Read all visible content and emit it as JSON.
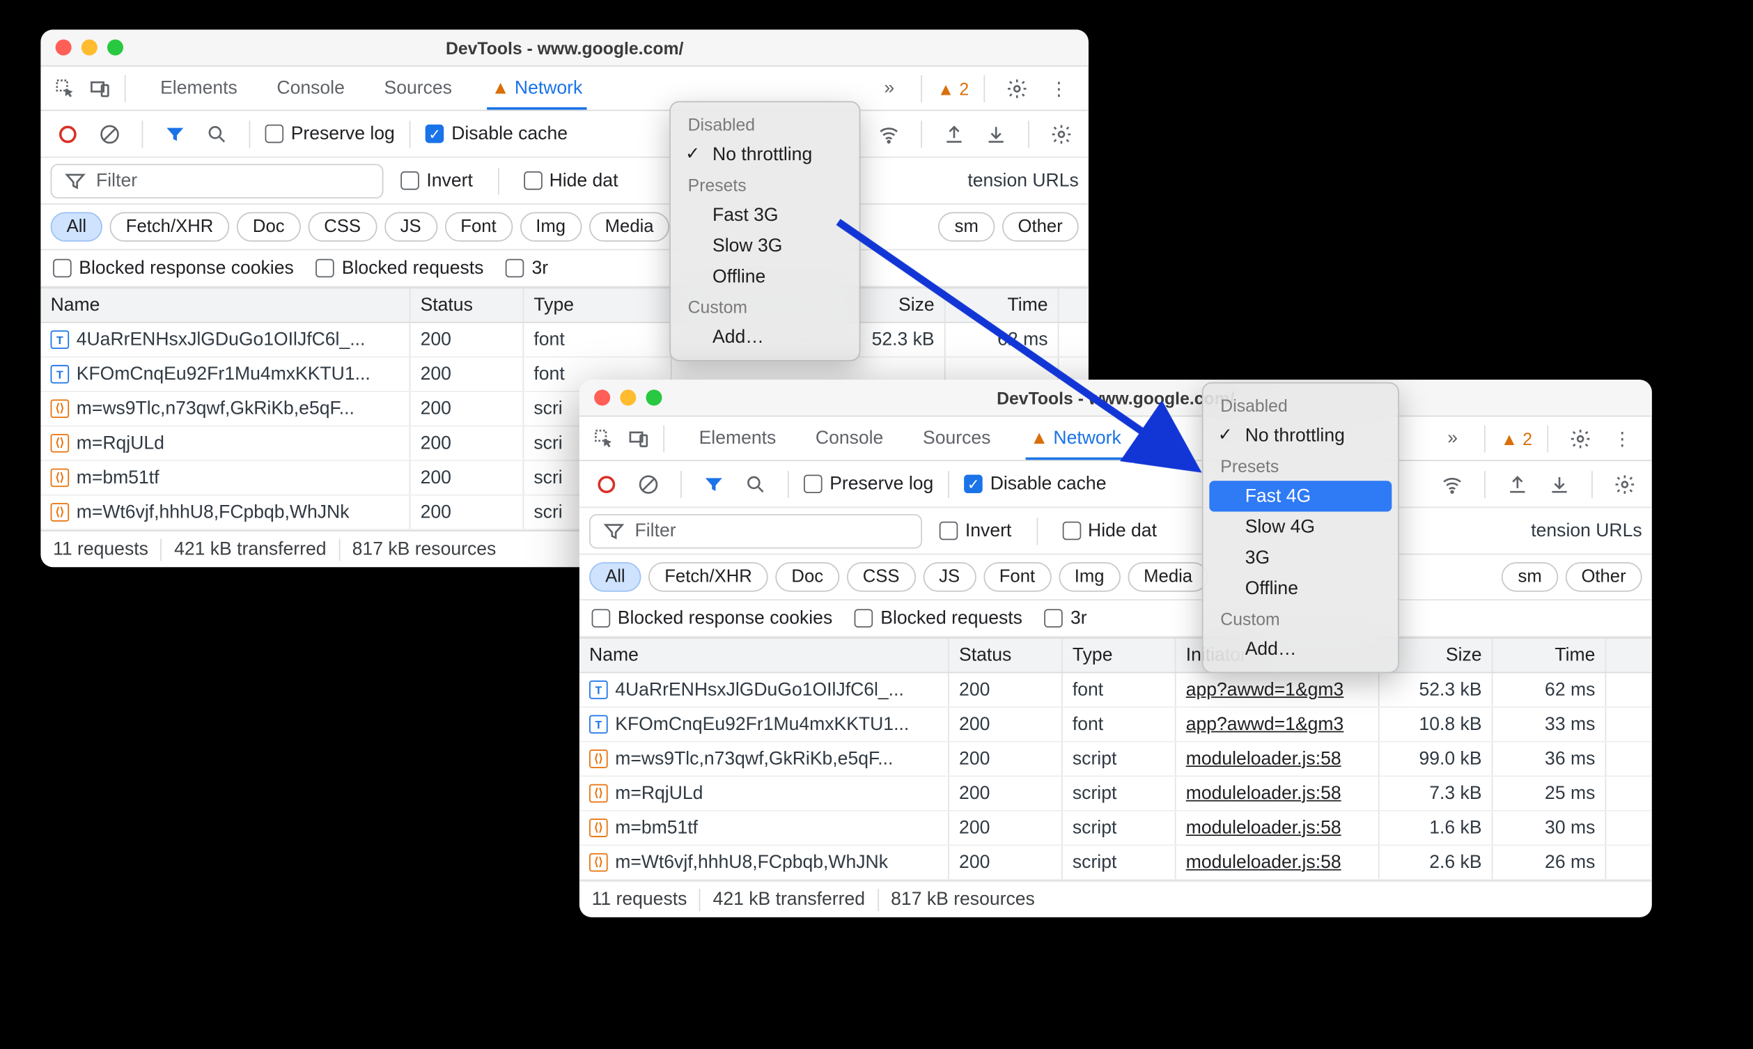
{
  "window_title": "DevTools - www.google.com/",
  "tabs": {
    "elements": "Elements",
    "console": "Console",
    "sources": "Sources",
    "network": "Network"
  },
  "warning_count": "2",
  "toolbar": {
    "preserve_log": "Preserve log",
    "disable_cache": "Disable cache"
  },
  "filter_placeholder": "Filter",
  "invert": "Invert",
  "hide_data_partial": "Hide dat",
  "extension_urls_partial": "tension URLs",
  "types": {
    "all": "All",
    "fetch": "Fetch/XHR",
    "doc": "Doc",
    "css": "CSS",
    "js": "JS",
    "font": "Font",
    "img": "Img",
    "media": "Media",
    "sm_partial": "sm",
    "other": "Other"
  },
  "checks": {
    "blocked_cookies": "Blocked response cookies",
    "blocked_requests": "Blocked requests",
    "third_partial": "3r"
  },
  "columns": {
    "name": "Name",
    "status": "Status",
    "type": "Type",
    "initiator": "Initiator",
    "size": "Size",
    "time": "Time"
  },
  "rows": [
    {
      "icon": "font",
      "name": "4UaRrENHsxJlGDuGo1OIlJfC6l_...",
      "status": "200",
      "type": "font",
      "initiator": "app?awwd=1&gm3",
      "size": "52.3 kB",
      "time": "62 ms"
    },
    {
      "icon": "font",
      "name": "KFOmCnqEu92Fr1Mu4mxKKTU1...",
      "status": "200",
      "type": "font",
      "initiator": "app?awwd=1&gm3",
      "size": "10.8 kB",
      "time": "33 ms"
    },
    {
      "icon": "script",
      "name": "m=ws9Tlc,n73qwf,GkRiKb,e5qF...",
      "status": "200",
      "type": "script",
      "initiator": "moduleloader.js:58",
      "size": "99.0 kB",
      "time": "36 ms"
    },
    {
      "icon": "script",
      "name": "m=RqjULd",
      "status": "200",
      "type": "script",
      "initiator": "moduleloader.js:58",
      "size": "7.3 kB",
      "time": "25 ms"
    },
    {
      "icon": "script",
      "name": "m=bm51tf",
      "status": "200",
      "type": "script",
      "initiator": "moduleloader.js:58",
      "size": "1.6 kB",
      "time": "30 ms"
    },
    {
      "icon": "script",
      "name": "m=Wt6vjf,hhhU8,FCpbqb,WhJNk",
      "status": "200",
      "type": "script",
      "initiator": "moduleloader.js:58",
      "size": "2.6 kB",
      "time": "26 ms"
    }
  ],
  "status": {
    "requests": "11 requests",
    "transferred": "421 kB transferred",
    "resources": "817 kB resources"
  },
  "menu_a": {
    "disabled": "Disabled",
    "no_throttling": "No throttling",
    "presets": "Presets",
    "fast3g": "Fast 3G",
    "slow3g": "Slow 3G",
    "offline": "Offline",
    "custom": "Custom",
    "add": "Add…"
  },
  "menu_b": {
    "disabled": "Disabled",
    "no_throttling": "No throttling",
    "presets": "Presets",
    "fast4g": "Fast 4G",
    "slow4g": "Slow 4G",
    "3g": "3G",
    "offline": "Offline",
    "custom": "Custom",
    "add": "Add…"
  },
  "left_rows": [
    {
      "icon": "font",
      "name": "4UaRrENHsxJlGDuGo1OIlJfC6l_...",
      "status": "200",
      "type": "font",
      "size": "52.3 kB",
      "time": "62 ms"
    },
    {
      "icon": "font",
      "name": "KFOmCnqEu92Fr1Mu4mxKKTU1...",
      "status": "200",
      "type": "font"
    },
    {
      "icon": "script",
      "name": "m=ws9Tlc,n73qwf,GkRiKb,e5qF...",
      "status": "200",
      "type": "scri"
    },
    {
      "icon": "script",
      "name": "m=RqjULd",
      "status": "200",
      "type": "scri"
    },
    {
      "icon": "script",
      "name": "m=bm51tf",
      "status": "200",
      "type": "scri"
    },
    {
      "icon": "script",
      "name": "m=Wt6vjf,hhhU8,FCpbqb,WhJNk",
      "status": "200",
      "type": "scri"
    }
  ]
}
